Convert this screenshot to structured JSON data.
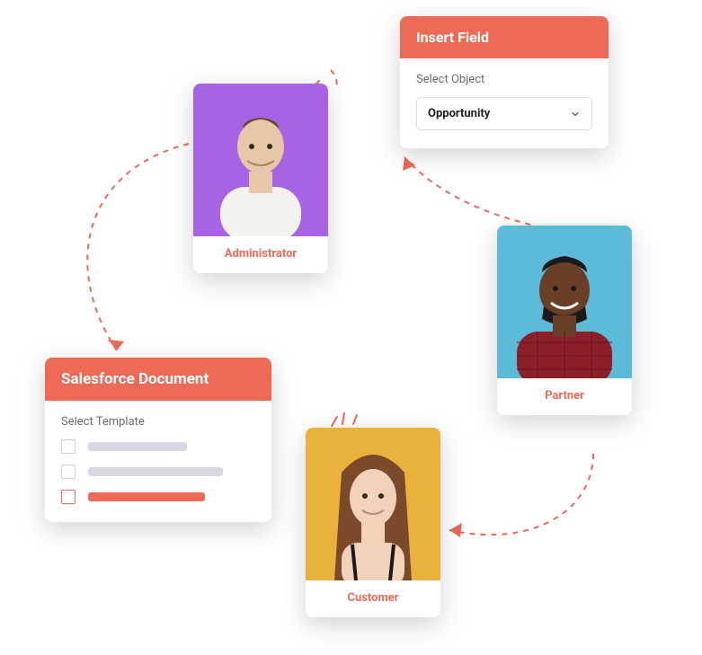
{
  "personas": {
    "admin": {
      "label": "Administrator"
    },
    "partner": {
      "label": "Partner"
    },
    "customer": {
      "label": "Customer"
    }
  },
  "insert_panel": {
    "title": "Insert Field",
    "subtitle": "Select Object",
    "selected": "Opportunity"
  },
  "doc_panel": {
    "title": "Salesforce Document",
    "subtitle": "Select Template"
  },
  "colors": {
    "accent": "#ec6a56"
  }
}
